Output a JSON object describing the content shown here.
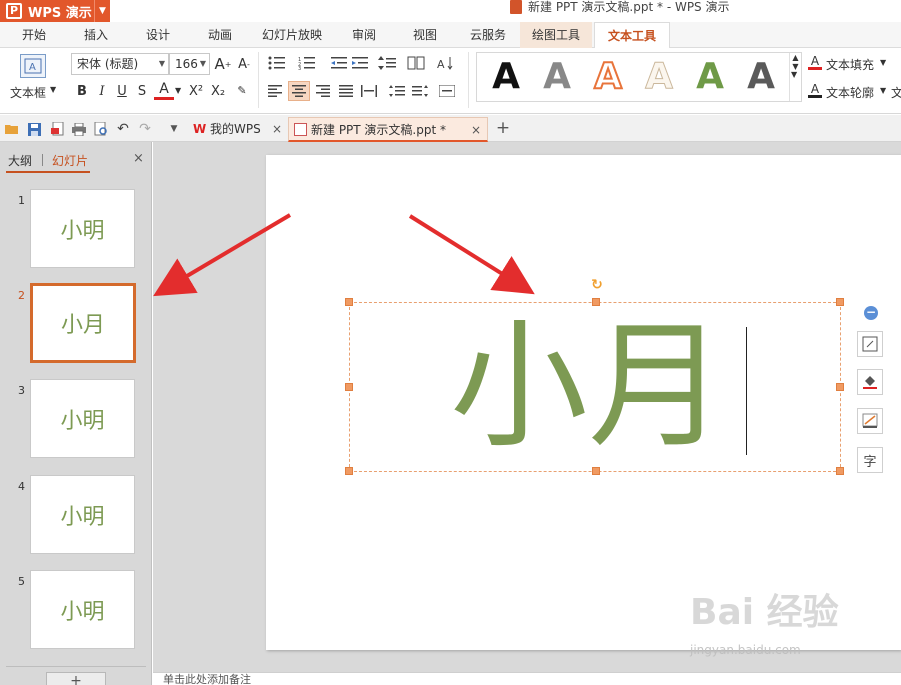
{
  "app": {
    "name": "WPS 演示",
    "window_title": "新建 PPT 演示文稿.ppt * - WPS 演示"
  },
  "tabs": [
    {
      "label": "开始"
    },
    {
      "label": "插入"
    },
    {
      "label": "设计"
    },
    {
      "label": "动画"
    },
    {
      "label": "幻灯片放映"
    },
    {
      "label": "审阅"
    },
    {
      "label": "视图"
    },
    {
      "label": "云服务"
    },
    {
      "label": "绘图工具"
    },
    {
      "label": "文本工具"
    }
  ],
  "ribbon": {
    "textbox_label": "文本框",
    "font_name": "宋体 (标题)",
    "font_size": "166",
    "grow_font": "A",
    "shrink_font": "A",
    "bold": "B",
    "italic": "I",
    "underline": "U",
    "strike": "S",
    "font_color": "A",
    "superscript": "X²",
    "subscript": "X₂",
    "text_fill_label": "文本填充",
    "text_outline_label": "文本轮廓",
    "text_effect_label": "文",
    "style_glyph": "A",
    "colors": {
      "accent": "#c6511f",
      "style_black": "#111111",
      "style_gray": "#777777",
      "style_orange": "#e8743b",
      "style_light": "#e7dccc",
      "style_green": "#6f9a47",
      "style_dark_gray": "#555555"
    }
  },
  "quickbar": {
    "doc_tabs": [
      {
        "label": "我的WPS",
        "close": "×"
      },
      {
        "label": "新建 PPT 演示文稿.ppt *",
        "close": "×"
      }
    ],
    "new_tab": "+"
  },
  "left_panel": {
    "tab_outline": "大纲",
    "tab_slides": "幻灯片",
    "close": "×",
    "slides": [
      {
        "num": "1",
        "text": "小明"
      },
      {
        "num": "2",
        "text": "小月"
      },
      {
        "num": "3",
        "text": "小明"
      },
      {
        "num": "4",
        "text": "小明"
      },
      {
        "num": "5",
        "text": "小明"
      }
    ],
    "add_button": "+"
  },
  "canvas": {
    "text": "小月",
    "text_color": "#7d9a53"
  },
  "notes": {
    "placeholder": "单击此处添加备注"
  },
  "watermark": {
    "logo": "Bai 经验",
    "url": "jingyan.baidu.com"
  }
}
